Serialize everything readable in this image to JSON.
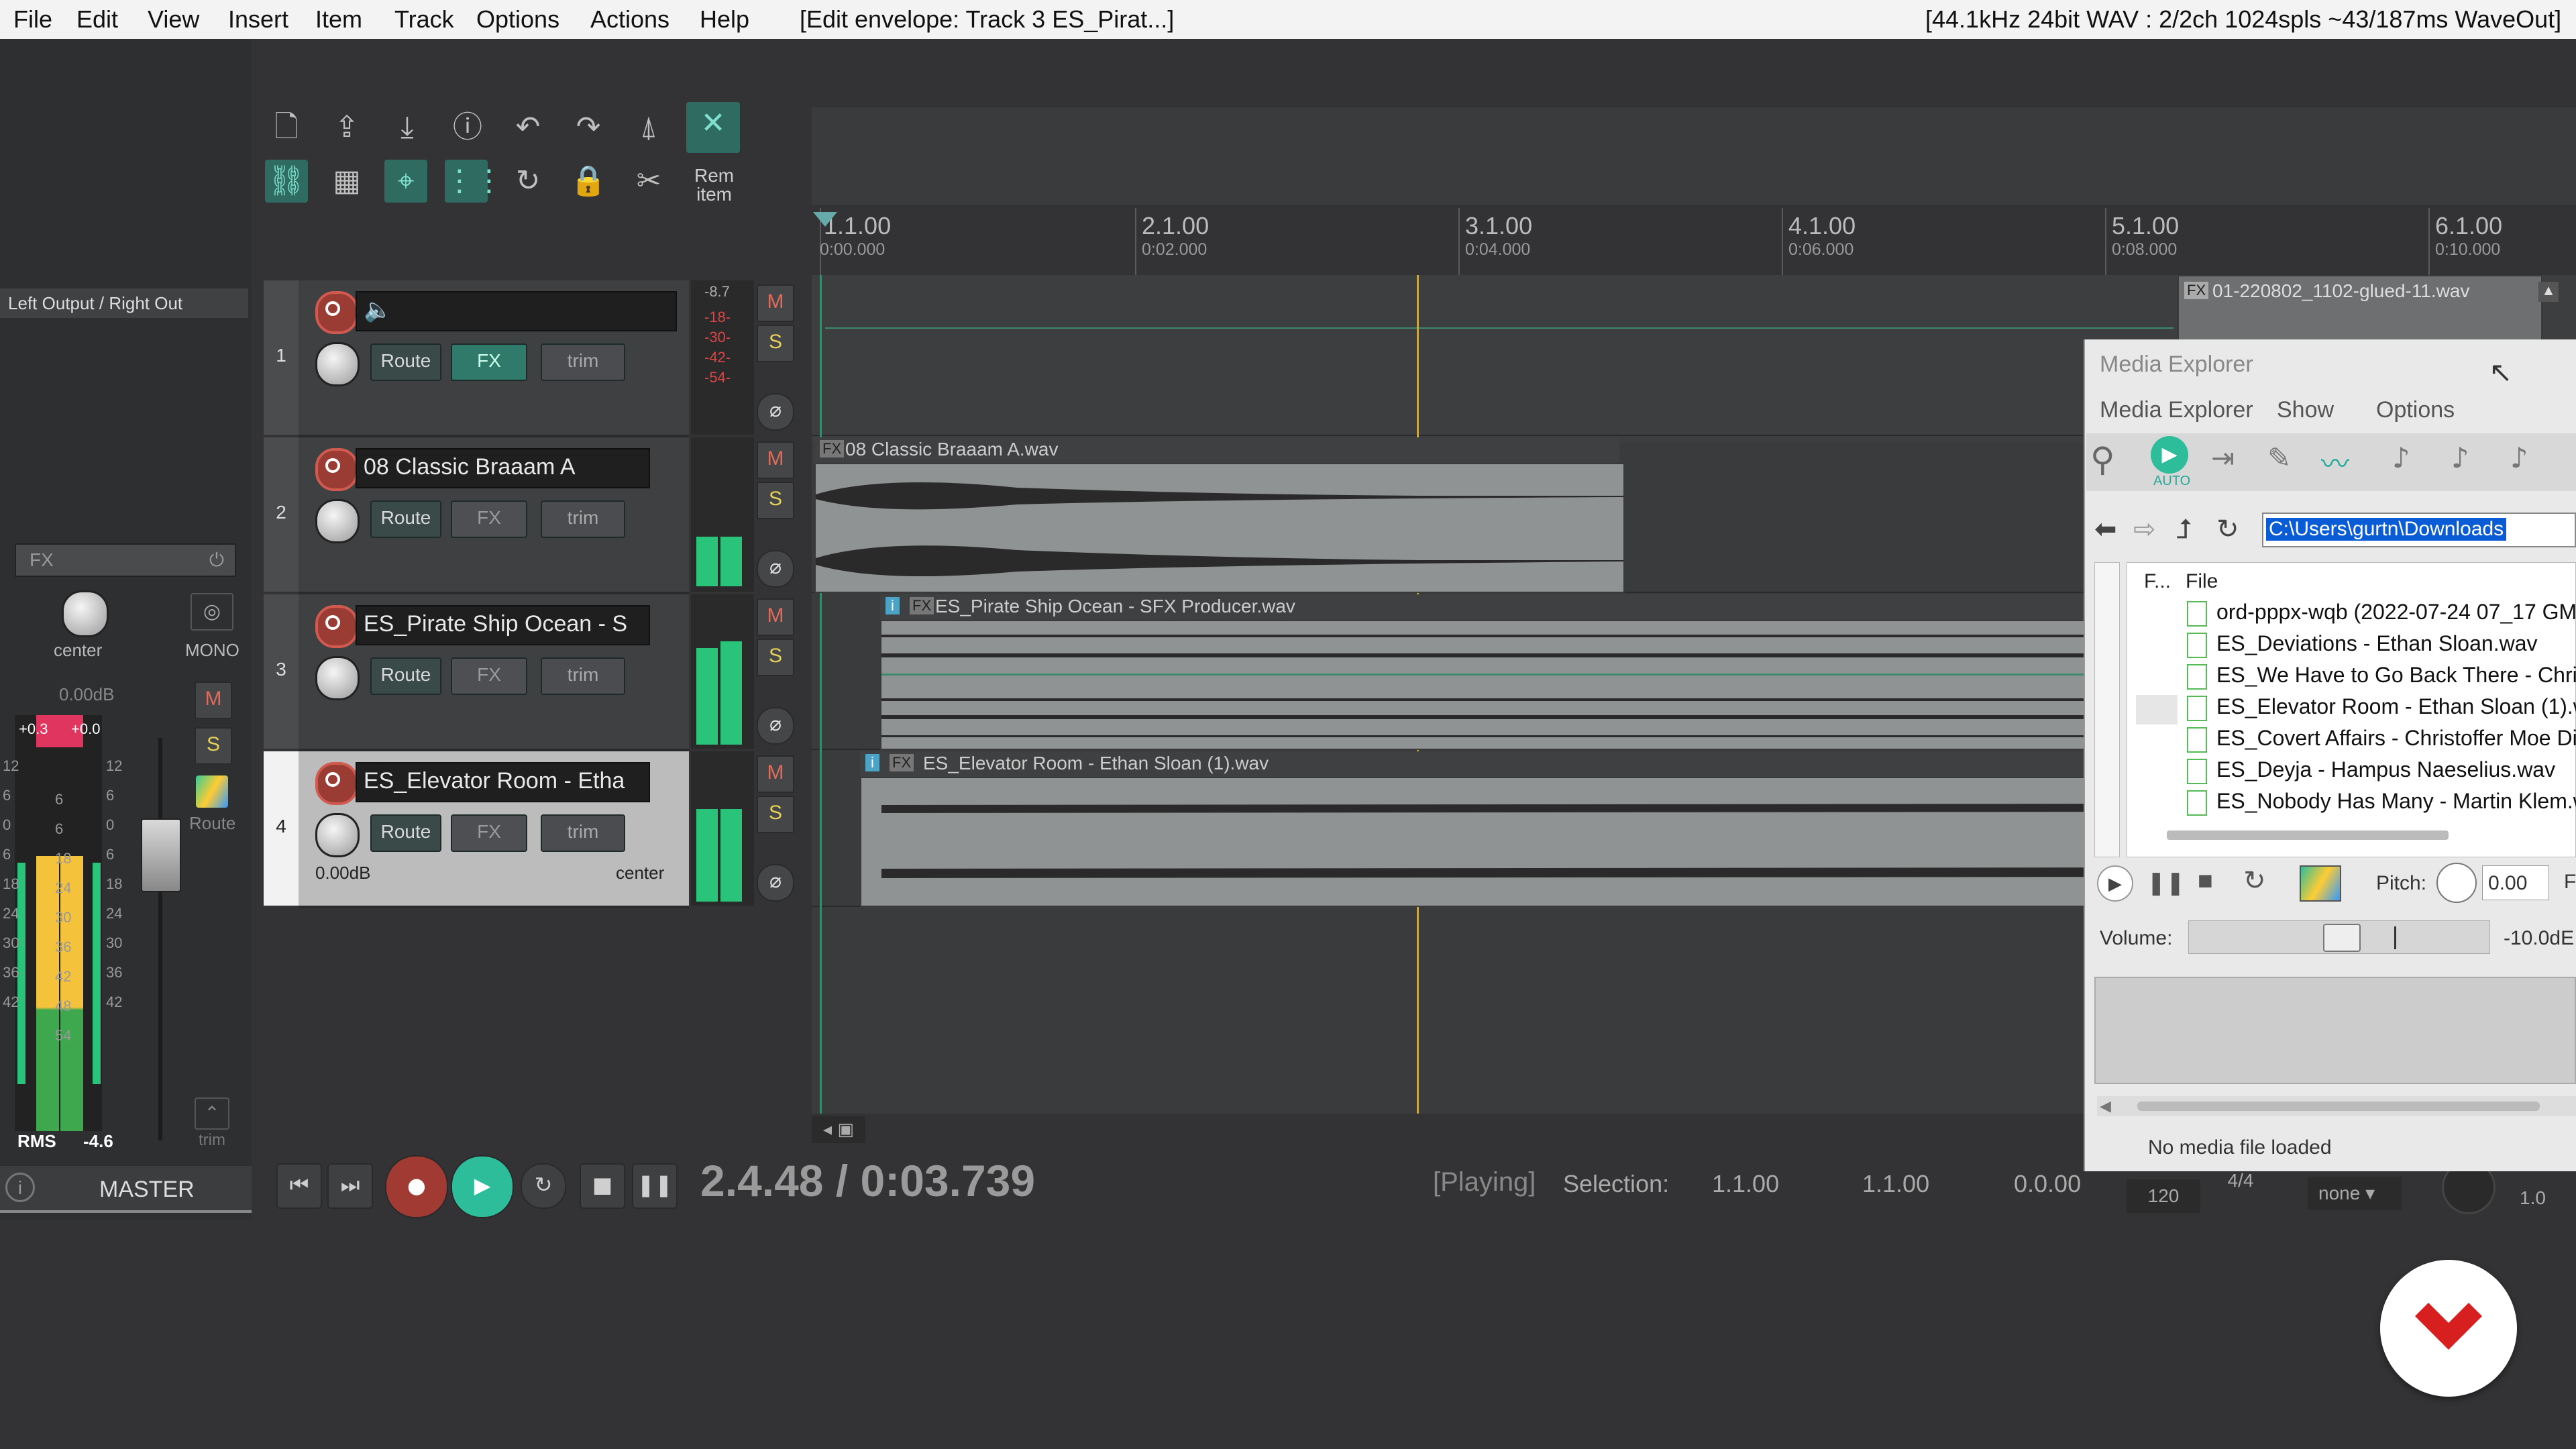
{
  "menubar": {
    "items": [
      "File",
      "Edit",
      "View",
      "Insert",
      "Item",
      "Track",
      "Options",
      "Actions",
      "Help"
    ],
    "title": "[Edit envelope: Track 3 ES_Pirat...]",
    "status": "[44.1kHz 24bit WAV : 2/2ch 1024spls ~43/187ms WaveOut]"
  },
  "toolbar": {
    "rem_item_line1": "Rem",
    "rem_item_line2": "item",
    "icons": [
      "new-file-icon",
      "save-up-icon",
      "save-down-icon",
      "info-icon",
      "undo-icon",
      "redo-icon",
      "metronome-icon",
      "ripple-icon",
      "link-icon",
      "grid-icon",
      "snap-icon",
      "grid-lines-icon",
      "loop-icon",
      "lock-icon",
      "cut-icon"
    ]
  },
  "ruler": {
    "marks": [
      {
        "bar": "1.1.00",
        "time": "0:00.000"
      },
      {
        "bar": "2.1.00",
        "time": "0:02.000"
      },
      {
        "bar": "3.1.00",
        "time": "0:04.000"
      },
      {
        "bar": "4.1.00",
        "time": "0:06.000"
      },
      {
        "bar": "5.1.00",
        "time": "0:08.000"
      },
      {
        "bar": "6.1.00",
        "time": "0:10.000"
      }
    ]
  },
  "master": {
    "output_label": "Left Output / Right Out",
    "fx_label": "FX",
    "pan_label": "center",
    "mono_label": "MONO",
    "volume": "0.00dB",
    "peak_left": "+0.3",
    "peak_right": "+0.0",
    "scale": [
      "12",
      "6",
      "0",
      "6",
      "12",
      "18",
      "24",
      "30",
      "36",
      "42",
      "48",
      "54"
    ],
    "scale_right": [
      "12",
      "6",
      "0",
      "6",
      "12",
      "18",
      "24",
      "30",
      "36",
      "42"
    ],
    "mute": "M",
    "solo": "S",
    "route_label": "Route",
    "trim_label": "trim",
    "rms_label": "RMS",
    "rms_value": "-4.6",
    "name": "MASTER"
  },
  "tracks": [
    {
      "num": "1",
      "name": "",
      "route": "Route",
      "fx": "FX",
      "trim": "trim",
      "mute": "M",
      "solo": "S",
      "meter_labels": [
        "-8.7",
        "-18-",
        "-30-",
        "-42-",
        "-54-"
      ]
    },
    {
      "num": "2",
      "name": "08 Classic Braaam A",
      "route": "Route",
      "fx": "FX",
      "trim": "trim",
      "mute": "M",
      "solo": "S"
    },
    {
      "num": "3",
      "name": "ES_Pirate Ship Ocean - S",
      "route": "Route",
      "fx": "FX",
      "trim": "trim",
      "mute": "M",
      "solo": "S"
    },
    {
      "num": "4",
      "name": "ES_Elevator Room - Etha",
      "route": "Route",
      "fx": "FX",
      "trim": "trim",
      "mute": "M",
      "solo": "S",
      "volume": "0.00dB",
      "pan": "center"
    }
  ],
  "items": {
    "glued": "01-220802_1102-glued-11.wav",
    "braaam": "08 Classic Braaam A.wav",
    "pirate": "ES_Pirate Ship Ocean - SFX Producer.wav",
    "elevator": "ES_Elevator Room - Ethan Sloan (1).wav",
    "badge_i": "i",
    "badge_fx": "FX"
  },
  "transport": {
    "position": "2.4.48 / 0:03.739",
    "state": "[Playing]",
    "selection_label": "Selection:",
    "sel_start": "1.1.00",
    "sel_end": "1.1.00",
    "sel_len": "0.0.00",
    "bpm": "120",
    "timesig": "4/4",
    "none_label": "none",
    "rate": "1.0"
  },
  "media_explorer": {
    "title": "Media Explorer",
    "menu": [
      "Media Explorer",
      "Show",
      "Options"
    ],
    "auto_label": "AUTO",
    "path": "C:\\Users\\gurtn\\Downloads",
    "col_f": "F...",
    "col_file": "File",
    "files": [
      "ord-pppx-wqb (2022-07-24 07_17 GM",
      "ES_Deviations - Ethan Sloan.wav",
      "ES_We Have to Go Back There - Chri",
      "ES_Elevator Room - Ethan Sloan (1).w",
      "ES_Covert Affairs - Christoffer Moe Di",
      "ES_Deyja - Hampus Naeselius.wav",
      "ES_Nobody Has Many - Martin Klem.w"
    ],
    "pitch_label": "Pitch:",
    "pitch_value": "0.00",
    "pitch_extra": "F",
    "volume_label": "Volume:",
    "volume_value": "-10.0dE",
    "status": "No media file loaded"
  }
}
